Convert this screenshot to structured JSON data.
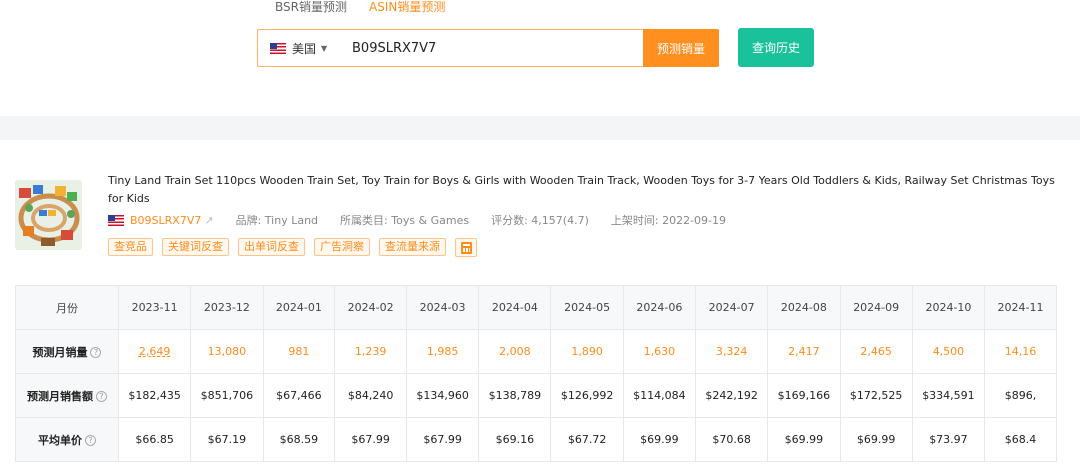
{
  "mode_tabs": [
    {
      "label": "BSR销量预测",
      "active": false
    },
    {
      "label": "ASIN销量预测",
      "active": true
    }
  ],
  "search": {
    "country": "美国",
    "flag_icon": "us-flag-icon",
    "value": "B09SLRX7V7",
    "predict_label": "预测销量",
    "history_label": "查询历史"
  },
  "product": {
    "title": "Tiny Land Train Set 110pcs Wooden Train Set, Toy Train for Boys & Girls with Wooden Train Track, Wooden Toys for 3-7 Years Old Toddlers & Kids, Railway Set Christmas Toys for Kids",
    "asin": "B09SLRX7V7",
    "brand": "品牌: Tiny Land",
    "category": "所属类目: Toys & Games",
    "rating": "评分数: 4,157(4.7)",
    "launch": "上架时间: 2022-09-19",
    "tools": [
      "查竞品",
      "关键词反查",
      "出单词反查",
      "广告洞察",
      "查流量来源"
    ]
  },
  "table": {
    "header_label": "月份",
    "months": [
      "2023-11",
      "2023-12",
      "2024-01",
      "2024-02",
      "2024-03",
      "2024-04",
      "2024-05",
      "2024-06",
      "2024-07",
      "2024-08",
      "2024-09",
      "2024-10",
      "2024-11"
    ],
    "rows": [
      {
        "label": "预测月销量",
        "kind": "sales",
        "values": [
          "2,649",
          "13,080",
          "981",
          "1,239",
          "1,985",
          "2,008",
          "1,890",
          "1,630",
          "3,324",
          "2,417",
          "2,465",
          "4,500",
          "14,16"
        ]
      },
      {
        "label": "预测月销售额",
        "kind": "rev",
        "values": [
          "$182,435",
          "$851,706",
          "$67,466",
          "$84,240",
          "$134,960",
          "$138,789",
          "$126,992",
          "$114,084",
          "$242,192",
          "$169,166",
          "$172,525",
          "$334,591",
          "$896,"
        ]
      },
      {
        "label": "平均单价",
        "kind": "price",
        "values": [
          "$66.85",
          "$67.19",
          "$68.59",
          "$67.99",
          "$67.99",
          "$69.16",
          "$67.72",
          "$69.99",
          "$70.68",
          "$69.99",
          "$69.99",
          "$73.97",
          "$68.4"
        ]
      }
    ]
  },
  "colors": {
    "accent": "#ff8c1a",
    "teal": "#19c29b"
  }
}
